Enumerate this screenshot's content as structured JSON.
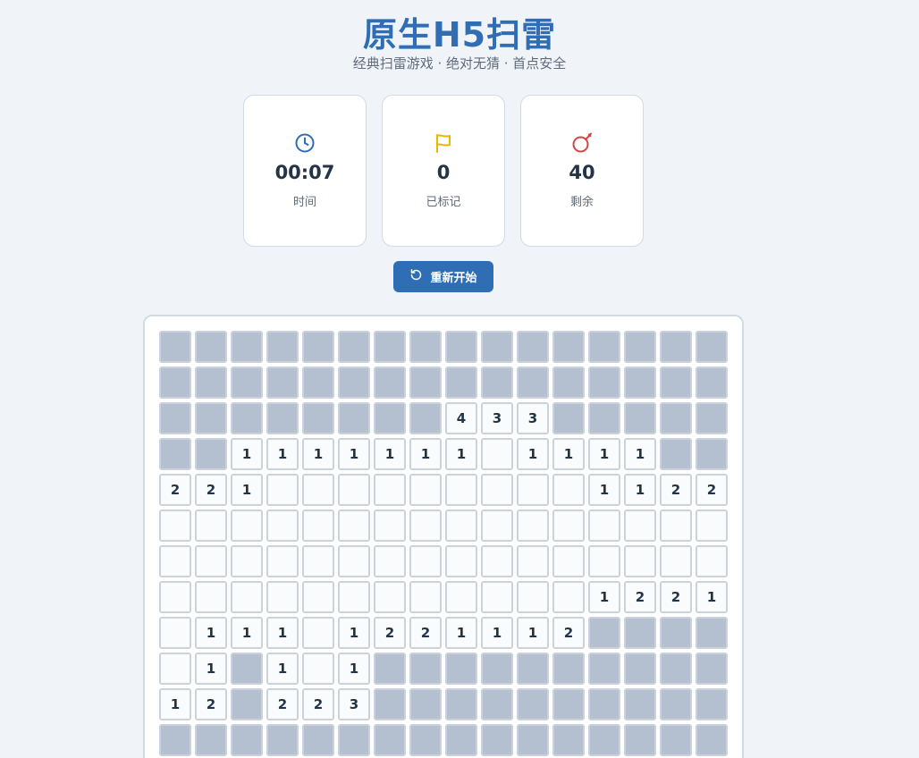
{
  "header": {
    "title": "原生H5扫雷",
    "subtitle": "经典扫雷游戏 · 绝对无猜 · 首点安全"
  },
  "stats": {
    "time": {
      "value": "00:07",
      "label": "时间",
      "icon": "clock-icon"
    },
    "flagged": {
      "value": "0",
      "label": "已标记",
      "icon": "flag-icon"
    },
    "remaining": {
      "value": "40",
      "label": "剩余",
      "icon": "bomb-icon"
    }
  },
  "controls": {
    "restart_label": "重新开始",
    "restart_icon": "restart-icon"
  },
  "colors": {
    "accent": "#2f6eb5",
    "flag": "#f0b400",
    "bomb": "#d64545",
    "hidden_cell": "#b4c0cf",
    "open_cell": "#fafbfc"
  },
  "board": {
    "legend": {
      "hidden": "#",
      "empty": "."
    },
    "rows": [
      "################",
      "################",
      "########433#####",
      "##1111111.1111##",
      "221.........1122",
      "................",
      "................",
      "............1221",
      ".111.1221112####",
      ".1#1.1##########",
      "12#223##########",
      "################"
    ]
  }
}
